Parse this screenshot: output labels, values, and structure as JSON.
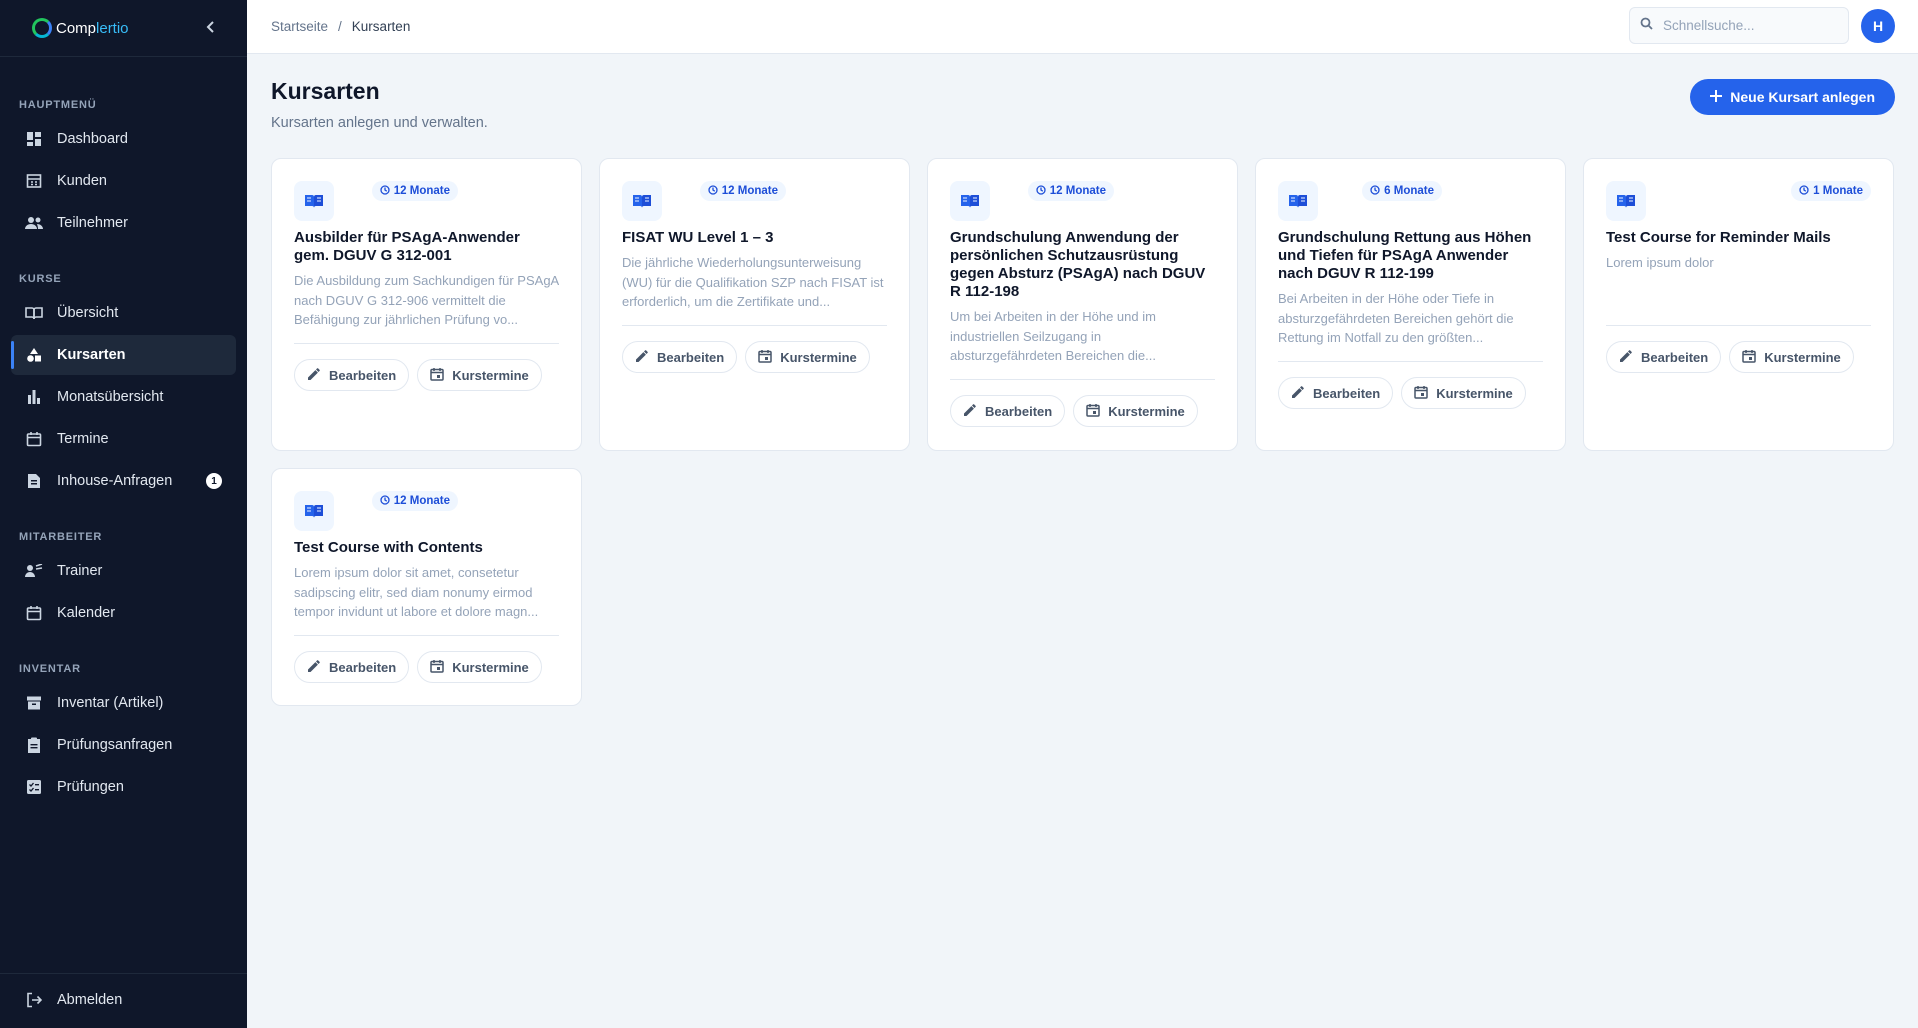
{
  "app": {
    "brand_prefix": "Comp",
    "brand_suffix": "lertio"
  },
  "sidebar": {
    "sections": {
      "main": "HAUPTMENÜ",
      "courses": "KURSE",
      "staff": "MITARBEITER",
      "inventory": "INVENTAR"
    },
    "items": {
      "dashboard": "Dashboard",
      "kunden": "Kunden",
      "teilnehmer": "Teilnehmer",
      "uebersicht": "Übersicht",
      "kursarten": "Kursarten",
      "monatsuebersicht": "Monatsübersicht",
      "termine": "Termine",
      "inhouse": "Inhouse-Anfragen",
      "inhouse_badge": "1",
      "trainer": "Trainer",
      "kalender": "Kalender",
      "inventar": "Inventar (Artikel)",
      "pruefungsanfragen": "Prüfungsanfragen",
      "pruefungen": "Prüfungen",
      "abmelden": "Abmelden"
    },
    "active": "kursarten"
  },
  "topbar": {
    "breadcrumb": [
      "Startseite",
      "/",
      "Kursarten"
    ],
    "search_placeholder": "Schnellsuche...",
    "avatar_initial": "H"
  },
  "page": {
    "title": "Kursarten",
    "subtitle": "Kursarten anlegen und verwalten.",
    "new_button": "Neue Kursart anlegen"
  },
  "cards": [
    {
      "duration": "12 Monate",
      "title": "Ausbilder für PSAgA-Anwender gem. DGUV G 312-001",
      "description": "Die Ausbildung zum Sachkundigen für PSAgA nach DGUV G 312-906 vermittelt die Befähigung zur jährlichen Prüfung vo...",
      "edit_label": "Bearbeiten",
      "dates_label": "Kurstermine"
    },
    {
      "duration": "12 Monate",
      "title": "FISAT WU Level 1 – 3",
      "description": "Die jährliche Wiederholungsunterweisung (WU) für die Qualifikation SZP nach FISAT ist erforderlich, um die Zertifikate und...",
      "edit_label": "Bearbeiten",
      "dates_label": "Kurstermine"
    },
    {
      "duration": "12 Monate",
      "title": "Grundschulung Anwendung der persönlichen Schutzausrüstung gegen Absturz (PSAgA) nach DGUV R 112-198",
      "description": "Um bei Arbeiten in der Höhe und im industriellen Seilzugang in absturzgefährdeten Bereichen die...",
      "edit_label": "Bearbeiten",
      "dates_label": "Kurstermine"
    },
    {
      "duration": "6 Monate",
      "title": "Grundschulung Rettung aus Höhen und Tiefen für PSAgA Anwender nach DGUV R 112-199",
      "description": "Bei Arbeiten in der Höhe oder Tiefe in absturzgefährdeten Bereichen gehört die Rettung im Notfall zu den größten...",
      "edit_label": "Bearbeiten",
      "dates_label": "Kurstermine"
    },
    {
      "duration": "1 Monate",
      "title": "Test Course for Reminder Mails",
      "description": "Lorem ipsum dolor",
      "edit_label": "Bearbeiten",
      "dates_label": "Kurstermine"
    },
    {
      "duration": "12 Monate",
      "title": "Test Course with Contents",
      "description": "Lorem ipsum dolor sit amet, consetetur sadipscing elitr, sed diam nonumy eirmod tempor invidunt ut labore et dolore magn...",
      "edit_label": "Bearbeiten",
      "dates_label": "Kurstermine"
    }
  ],
  "colors": {
    "accent": "#2563eb",
    "sidebar_bg": "#0f172a",
    "page_bg": "#f1f5f9"
  }
}
